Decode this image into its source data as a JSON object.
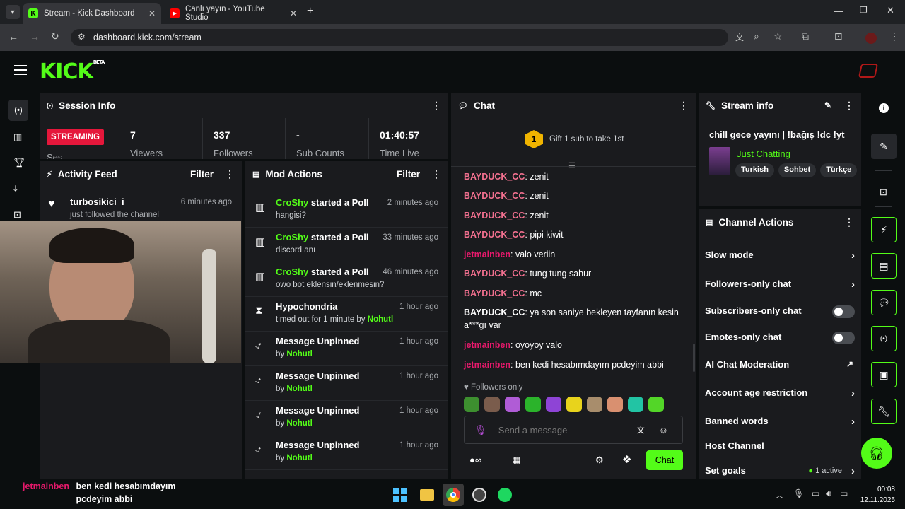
{
  "browser": {
    "tabs": [
      {
        "title": "Stream - Kick Dashboard",
        "active": true
      },
      {
        "title": "Canlı yayın - YouTube Studio",
        "active": false
      }
    ],
    "url": "dashboard.kick.com/stream"
  },
  "brand": {
    "logo": "KICK",
    "badge": "BETA",
    "accent": "#53fc18"
  },
  "session": {
    "title": "Session Info",
    "status": "STREAMING",
    "status_sub": "Ses",
    "stats": [
      {
        "value": "7",
        "label": "Viewers"
      },
      {
        "value": "337",
        "label": "Followers"
      },
      {
        "value": "-",
        "label": "Sub Counts"
      },
      {
        "value": "01:40:57",
        "label": "Time Live"
      }
    ]
  },
  "activity": {
    "title": "Activity Feed",
    "filter": "Filter",
    "items": [
      {
        "user": "turbosikici_i",
        "text": "just followed the channel",
        "time": "6 minutes ago"
      }
    ]
  },
  "mod": {
    "title": "Mod Actions",
    "filter": "Filter",
    "items": [
      {
        "icon": "poll-icon",
        "user": "CroShy",
        "action": "started a Poll",
        "detail": "hangisi?",
        "time": "2 minutes ago"
      },
      {
        "icon": "poll-icon",
        "user": "CroShy",
        "action": "started a Poll",
        "detail": "discord anı",
        "time": "33 minutes ago"
      },
      {
        "icon": "poll-icon",
        "user": "CroShy",
        "action": "started a Poll",
        "detail": "owo bot eklensin/eklenmesin?",
        "time": "46 minutes ago"
      },
      {
        "icon": "hourglass-icon",
        "user": "Hypochondria",
        "action": "",
        "detail": "timed out for 1 minute by",
        "by": "Nohutl",
        "time": "1 hour ago"
      },
      {
        "icon": "unpin-icon",
        "user": "Message Unpinned",
        "action": "",
        "detail": "by",
        "by": "Nohutl",
        "time": "1 hour ago"
      },
      {
        "icon": "unpin-icon",
        "user": "Message Unpinned",
        "action": "",
        "detail": "by",
        "by": "Nohutl",
        "time": "1 hour ago"
      },
      {
        "icon": "unpin-icon",
        "user": "Message Unpinned",
        "action": "",
        "detail": "by",
        "by": "Nohutl",
        "time": "1 hour ago"
      },
      {
        "icon": "unpin-icon",
        "user": "Message Unpinned",
        "action": "",
        "detail": "by",
        "by": "Nohutl",
        "time": "1 hour ago"
      }
    ]
  },
  "chat": {
    "title": "Chat",
    "gift_badge": "1",
    "gift_text": "Gift 1 sub to take 1st",
    "messages": [
      {
        "user": "BAYDUCK_CC",
        "color": "pink",
        "text": "zenit"
      },
      {
        "user": "BAYDUCK_CC",
        "color": "pink",
        "text": "zenit"
      },
      {
        "user": "BAYDUCK_CC",
        "color": "pink",
        "text": "zenit"
      },
      {
        "user": "BAYDUCK_CC",
        "color": "pink",
        "text": "pipi kiwit"
      },
      {
        "user": "jetmainben",
        "color": "red",
        "text": "valo veriin"
      },
      {
        "user": "BAYDUCK_CC",
        "color": "pink",
        "text": "tung tung sahur"
      },
      {
        "user": "BAYDUCK_CC",
        "color": "pink",
        "text": "mc"
      },
      {
        "user": "BAYDUCK_CC",
        "color": "white",
        "text": "ya son saniye bekleyen tayfanın kesin a***gı var"
      },
      {
        "user": "jetmainben",
        "color": "red",
        "text": "oyoyoy valo"
      },
      {
        "user": "jetmainben",
        "color": "red",
        "text": "ben kedi hesabımdayım pcdeyim abbi"
      }
    ],
    "followers_only": "Followers only",
    "placeholder": "Send a message",
    "send": "Chat"
  },
  "stream_info": {
    "title": "Stream info",
    "stream_title": "chill gece yayını | !bağış !dc !yt",
    "category": "Just Chatting",
    "tags": [
      "Turkish",
      "Sohbet",
      "Türkçe"
    ]
  },
  "channel_actions": {
    "title": "Channel Actions",
    "items": [
      {
        "label": "Slow mode",
        "control": "chevron"
      },
      {
        "label": "Followers-only chat",
        "control": "chevron"
      },
      {
        "label": "Subscribers-only chat",
        "control": "toggle"
      },
      {
        "label": "Emotes-only chat",
        "control": "toggle"
      },
      {
        "label": "AI Chat Moderation",
        "control": "external"
      },
      {
        "label": "Account age restriction",
        "control": "chevron"
      },
      {
        "label": "Banned words",
        "control": "chevron"
      },
      {
        "label": "Host Channel",
        "control": "none"
      },
      {
        "label": "Set goals",
        "control": "chevron",
        "extra": "1 active"
      }
    ]
  },
  "overlay_chat": {
    "user": "jetmainben",
    "text": "ben kedi hesabımdayım pcdeyim abbi"
  },
  "clock": {
    "time": "00:08",
    "date": "12.11.2025"
  }
}
